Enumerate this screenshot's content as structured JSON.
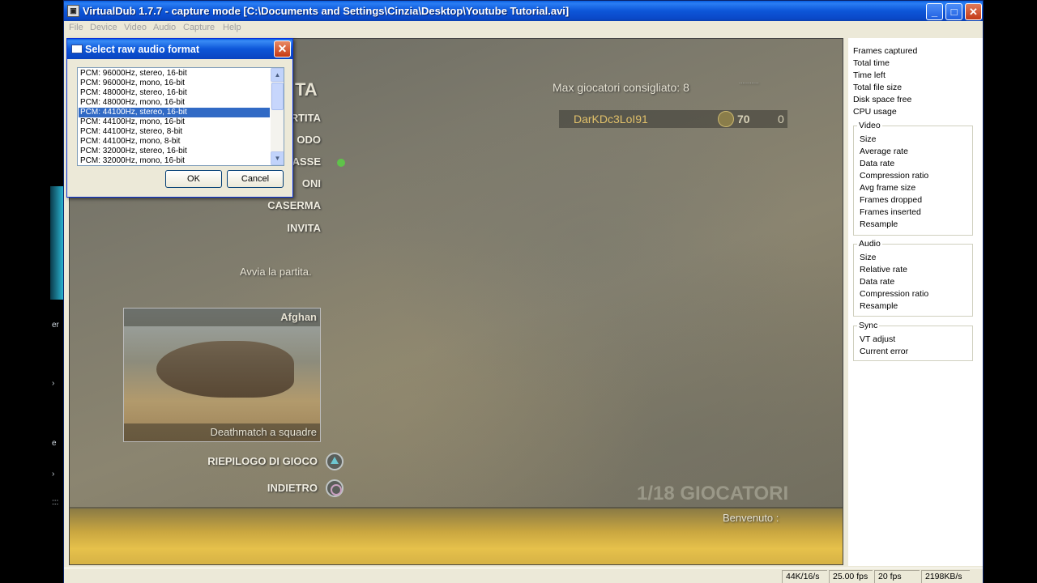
{
  "window": {
    "title": "VirtualDub 1.7.7 - capture mode [C:\\Documents and Settings\\Cinzia\\Desktop\\Youtube Tutorial.avi]",
    "minimize": "_",
    "maximize": "□",
    "close": "✕"
  },
  "menu": [
    "File",
    "Device",
    "Video",
    "Audio",
    "Capture",
    "Help"
  ],
  "left_fragments": [
    "er",
    "›",
    "e",
    "›",
    ":::"
  ],
  "preview": {
    "heading_fragment": "TA",
    "max_players": "Max giocatori consigliato: 8",
    "top_right_fragment": "...........",
    "player": {
      "name": "DarKDc3LoI91",
      "level": "70",
      "score": "0"
    },
    "menu": [
      "RTITA",
      "ODO",
      "ASSE",
      "ONI",
      "CASERMA",
      "INVITA"
    ],
    "hint": "Avvia la partita.",
    "map_name": "Afghan",
    "mode": "Deathmatch a squadre",
    "summary": "RIEPILOGO DI GIOCO",
    "back": "INDIETRO",
    "players_count": "1/18 GIOCATORI",
    "welcome": "Benvenuto :"
  },
  "stats": {
    "top": [
      "Frames captured",
      "Total time",
      "Time left",
      "Total file size",
      "Disk space free",
      "CPU usage"
    ],
    "video_title": "Video",
    "video": [
      "Size",
      "Average rate",
      "Data rate",
      "Compression ratio",
      "Avg frame size",
      "Frames dropped",
      "Frames inserted",
      "Resample"
    ],
    "audio_title": "Audio",
    "audio": [
      "Size",
      "Relative rate",
      "Data rate",
      "Compression ratio",
      "Resample"
    ],
    "sync_title": "Sync",
    "sync": [
      "VT adjust",
      "Current error"
    ]
  },
  "statusbar": [
    "44K/16/s",
    "25.00 fps",
    "20 fps",
    "2198KB/s"
  ],
  "dialog": {
    "title": "Select raw audio format",
    "close": "✕",
    "formats": [
      "PCM: 96000Hz, stereo, 16-bit",
      "PCM: 96000Hz, mono, 16-bit",
      "PCM: 48000Hz, stereo, 16-bit",
      "PCM: 48000Hz, mono, 16-bit",
      "PCM: 44100Hz, stereo, 16-bit",
      "PCM: 44100Hz, mono, 16-bit",
      "PCM: 44100Hz, stereo, 8-bit",
      "PCM: 44100Hz, mono, 8-bit",
      "PCM: 32000Hz, stereo, 16-bit",
      "PCM: 32000Hz, mono, 16-bit"
    ],
    "selected_index": 4,
    "ok": "OK",
    "cancel": "Cancel",
    "scroll_up": "▲",
    "scroll_down": "▼"
  },
  "colors": {
    "titlebar": "#0a5ee0",
    "selection": "#316ac5",
    "window_bg": "#ece9d8"
  }
}
